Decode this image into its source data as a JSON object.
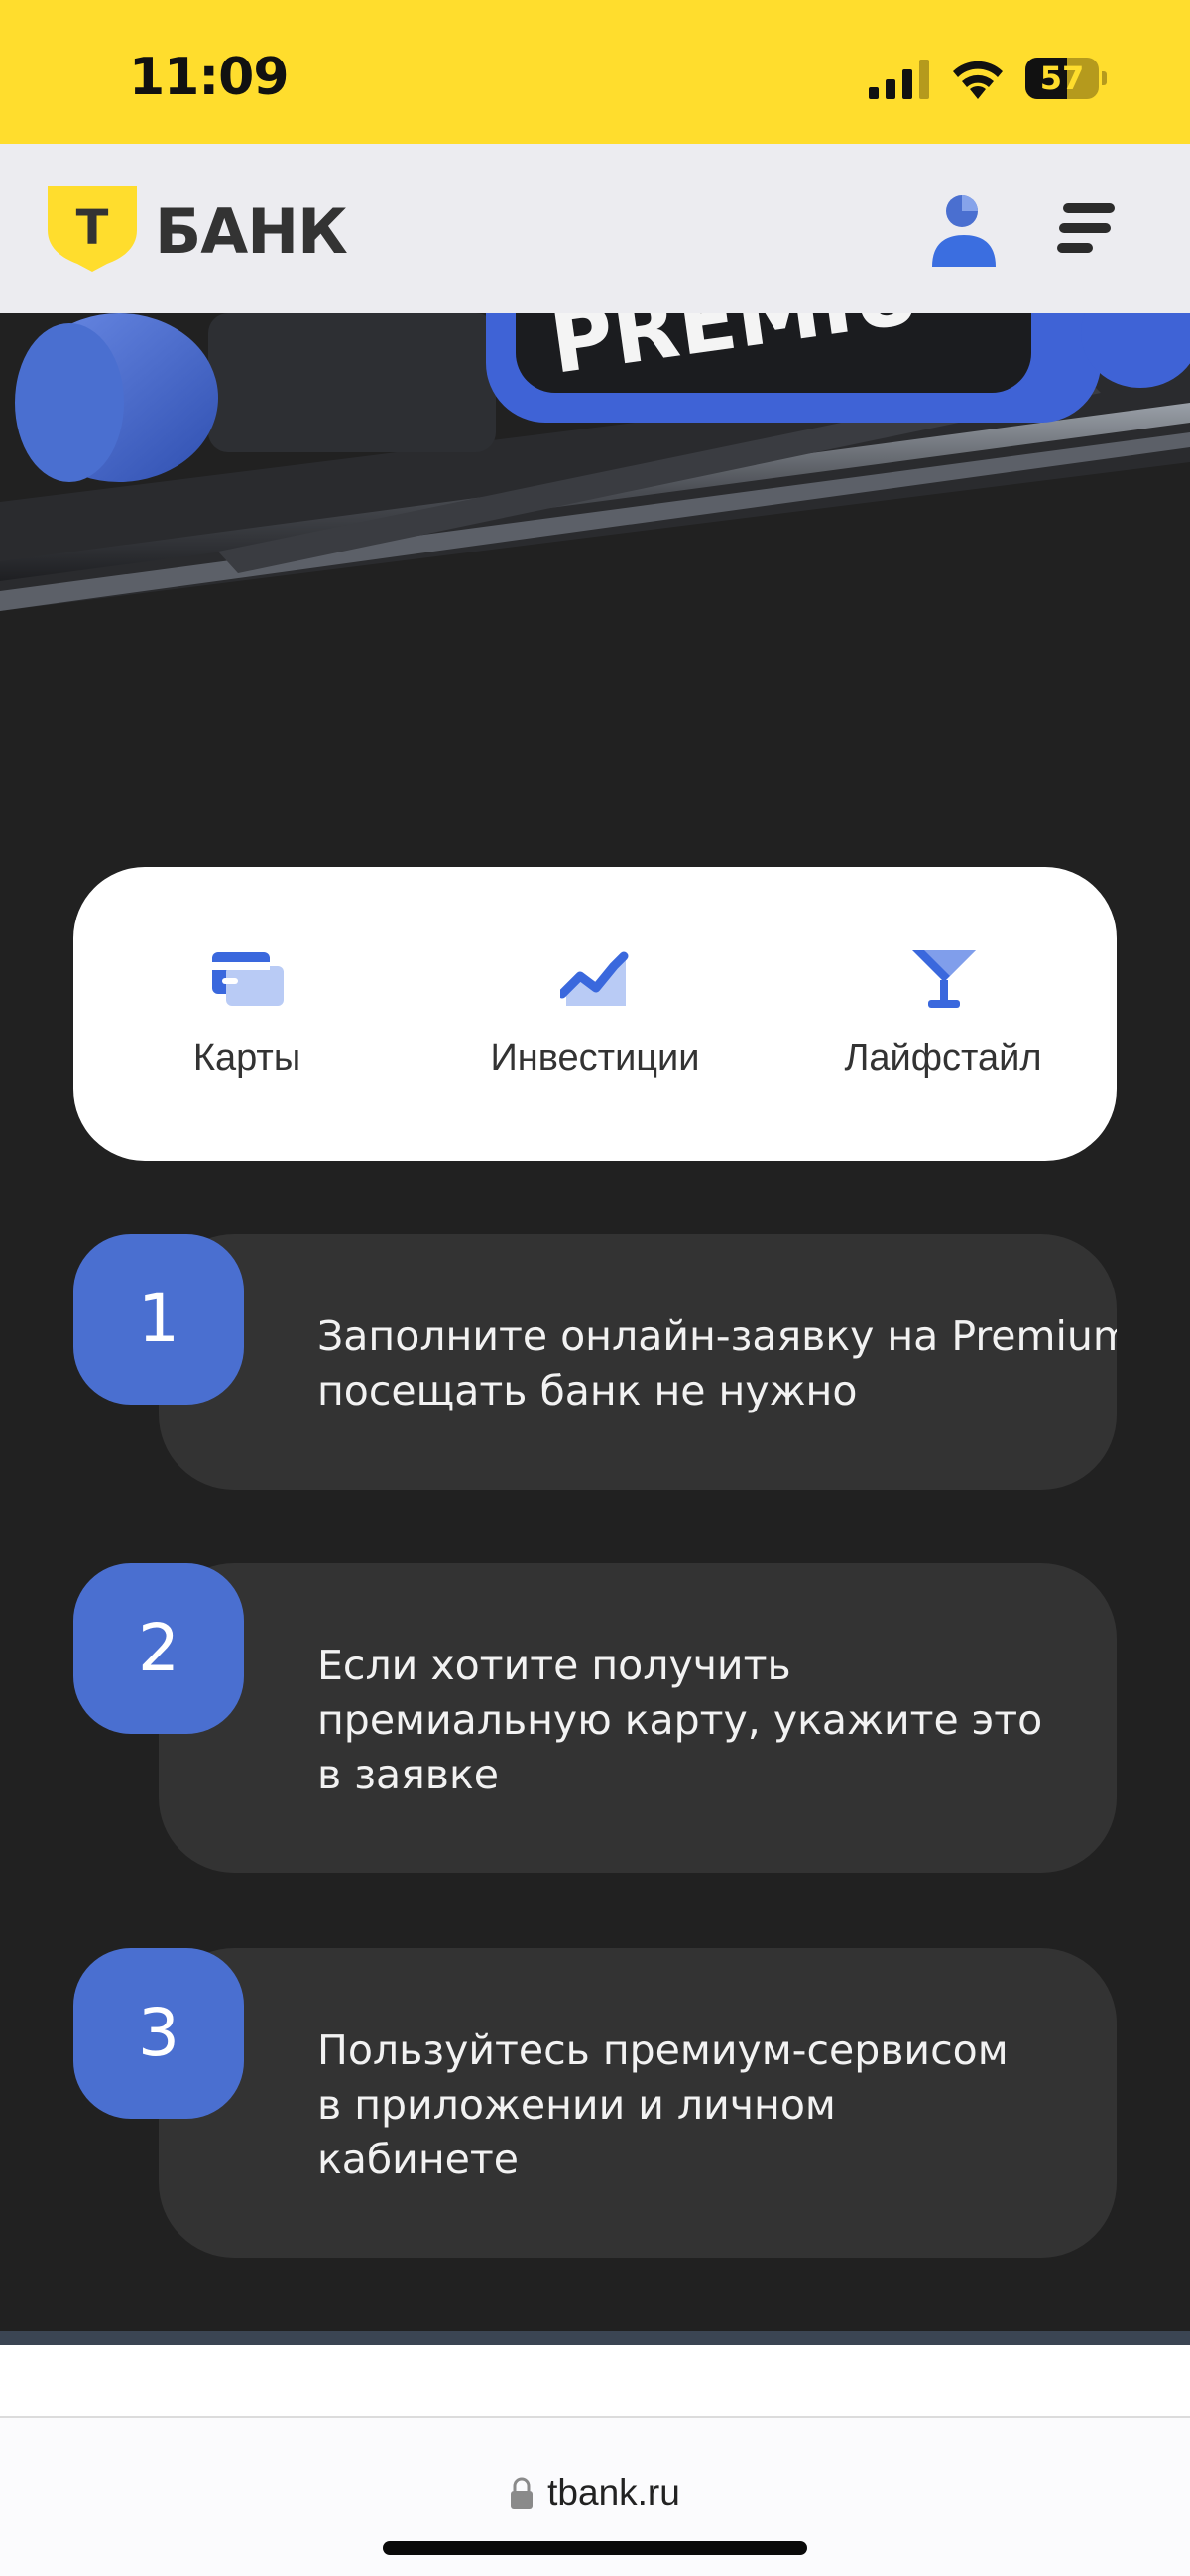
{
  "status_bar": {
    "time": "11:09",
    "battery_level": "57",
    "battery_fraction": 0.57,
    "background": "#ffdd2d"
  },
  "header": {
    "logo_letter": "Т",
    "logo_text": "БАНК",
    "profile_icon": "user-icon",
    "menu_icon": "menu-icon"
  },
  "hero": {
    "sign_text": "PREMIU"
  },
  "categories": [
    {
      "label": "Карты",
      "icon": "card-icon"
    },
    {
      "label": "Инвестиции",
      "icon": "chart-icon"
    },
    {
      "label": "Лайфстайл",
      "icon": "cocktail-icon"
    }
  ],
  "steps": [
    {
      "number": "1",
      "lines": [
        "Заполните онлайн-заявку на Premium,",
        "посещать банк не нужно"
      ]
    },
    {
      "number": "2",
      "lines": [
        "Если хотите получить",
        "премиальную карту, укажите это",
        "в заявке"
      ]
    },
    {
      "number": "3",
      "lines": [
        "Пользуйтесь премиум-сервисом",
        "в приложении и личном",
        "кабинете"
      ]
    }
  ],
  "browser": {
    "url": "tbank.ru"
  },
  "colors": {
    "accent_blue": "#4a6fd0",
    "page_dark": "#212121",
    "card_dark": "#333333",
    "brand_yellow": "#ffdd2d"
  }
}
